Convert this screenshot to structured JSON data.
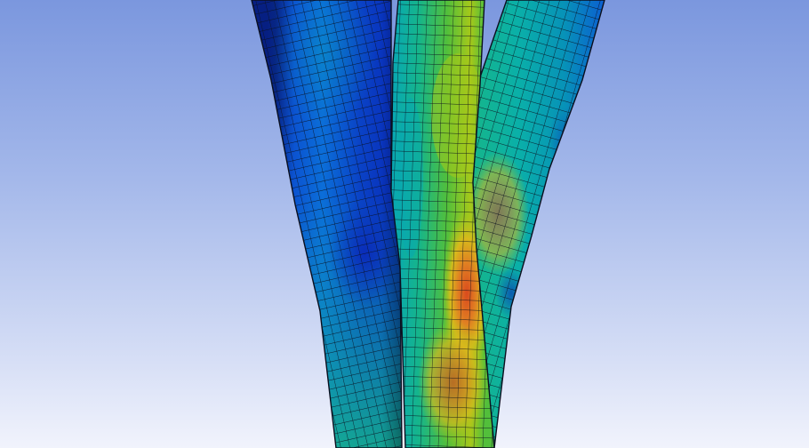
{
  "viewport": {
    "background_top": "#7B97DE",
    "background_bottom": "#F1F3FC",
    "mesh_line_color": "#0A0F1E",
    "contour_colors": [
      "#0A2FC8",
      "#0B6ED8",
      "#07A7B6",
      "#16B58A",
      "#52BF3B",
      "#A6C81A",
      "#D8B91C",
      "#E07E22",
      "#D94A1E"
    ]
  }
}
